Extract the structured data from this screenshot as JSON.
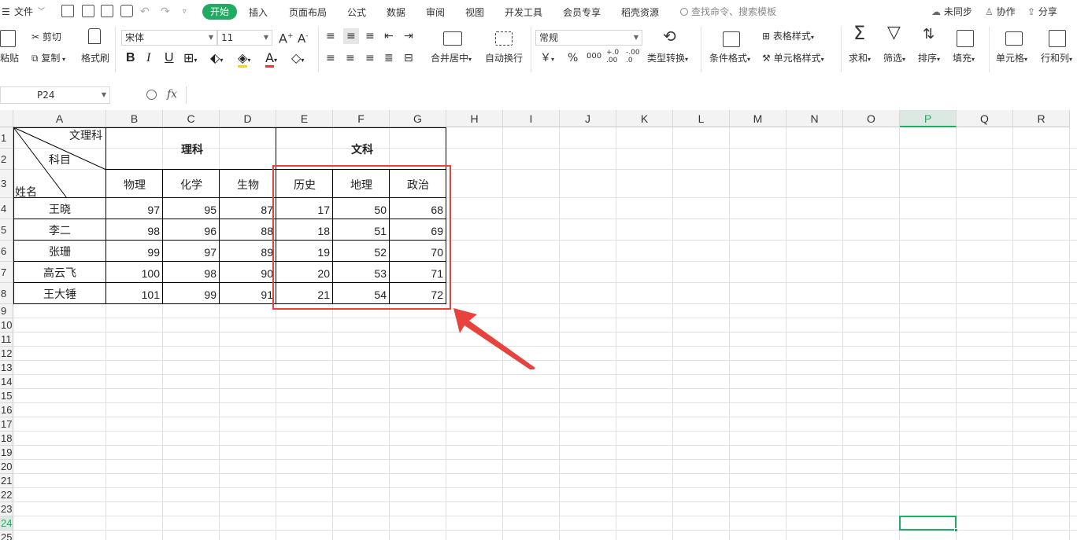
{
  "menubar": {
    "file": "文件",
    "tabs": [
      "开始",
      "插入",
      "页面布局",
      "公式",
      "数据",
      "审阅",
      "视图",
      "开发工具",
      "会员专享",
      "稻壳资源"
    ],
    "search": "查找命令、搜索模板",
    "right": [
      "未同步",
      "协作",
      "分享"
    ]
  },
  "ribbon": {
    "paste": "粘贴",
    "cut": "剪切",
    "copy": "复制",
    "format_painter": "格式刷",
    "font_name": "宋体",
    "font_size": "11",
    "bold": "B",
    "italic": "I",
    "underline": "U",
    "merge_center": "合并居中",
    "auto_wrap": "自动换行",
    "number_format": "常规",
    "currency": "￥",
    "percent": "%",
    "thousands": "000",
    "inc_decimal": "+.0\n.00",
    "dec_decimal": "-.00\n.0",
    "type_convert": "类型转换",
    "cond_format": "条件格式",
    "table_style": "表格样式",
    "cell_style": "单元格样式",
    "sum": "求和",
    "filter": "筛选",
    "sort": "排序",
    "fill": "填充",
    "cell": "单元格",
    "row_col": "行和列"
  },
  "formula_bar": {
    "name_box": "P24",
    "fx": "fx",
    "value": ""
  },
  "sheet": {
    "columns": [
      "A",
      "B",
      "C",
      "D",
      "E",
      "F",
      "G",
      "H",
      "I",
      "J",
      "K",
      "L",
      "M",
      "N",
      "O",
      "P",
      "Q",
      "R"
    ],
    "selected_column": "P",
    "row_numbers": [
      "1",
      "2",
      "3",
      "4",
      "5",
      "6",
      "7",
      "8",
      "9",
      "10",
      "11",
      "12",
      "13",
      "14",
      "15",
      "16",
      "17",
      "18",
      "19",
      "20",
      "21",
      "22",
      "23",
      "24",
      "25"
    ],
    "selected_row": "24",
    "header": {
      "diag_top": "文理科",
      "diag_mid": "科目",
      "diag_bottom": "姓名",
      "science": "理科",
      "liberal": "文科",
      "subjects": [
        "物理",
        "化学",
        "生物",
        "历史",
        "地理",
        "政治"
      ]
    },
    "rows": [
      {
        "name": "王晓",
        "values": [
          "97",
          "95",
          "87",
          "17",
          "50",
          "68"
        ]
      },
      {
        "name": "李二",
        "values": [
          "98",
          "96",
          "88",
          "18",
          "51",
          "69"
        ]
      },
      {
        "name": "张珊",
        "values": [
          "99",
          "97",
          "89",
          "19",
          "52",
          "70"
        ]
      },
      {
        "name": "高云飞",
        "values": [
          "100",
          "98",
          "90",
          "20",
          "53",
          "71"
        ]
      },
      {
        "name": "王大锤",
        "values": [
          "101",
          "99",
          "91",
          "21",
          "54",
          "72"
        ]
      }
    ],
    "accent_color": "#1fab61",
    "highlight_color": "#e8423f"
  }
}
